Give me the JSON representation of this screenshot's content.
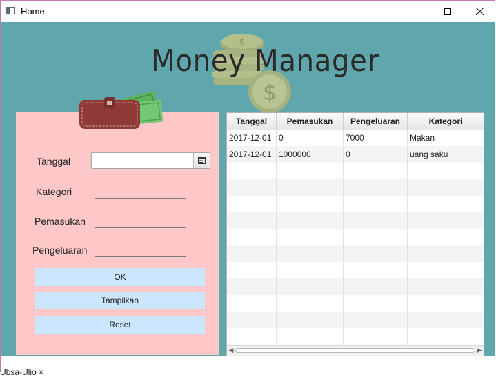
{
  "window": {
    "title": "Home",
    "controls": [
      "minimize",
      "maximize",
      "close"
    ]
  },
  "app": {
    "heading": "Money Manager"
  },
  "form": {
    "tanggal_label": "Tanggal",
    "kategori_label": "Kategori",
    "pemasukan_label": "Pemasukan",
    "pengeluaran_label": "Pengeluaran",
    "tanggal_value": "",
    "kategori_value": "",
    "pemasukan_value": "",
    "pengeluaran_value": "",
    "ok_label": "OK",
    "tampilkan_label": "Tampilkan",
    "reset_label": "Reset"
  },
  "table": {
    "columns": [
      "Tanggal",
      "Pemasukan",
      "Pengeluaran",
      "Kategori"
    ],
    "rows": [
      [
        "2017-12-01",
        "0",
        "7000",
        "Makan"
      ],
      [
        "2017-12-01",
        "1000000",
        "0",
        "uang saku"
      ]
    ]
  },
  "taskbar": {
    "snippet": "Ubsa-Ulio  ×"
  },
  "colors": {
    "background": "#5fa6ad",
    "form_panel": "#ffc8c8",
    "button": "#cce6ff",
    "heading": "#2b2b2b"
  }
}
